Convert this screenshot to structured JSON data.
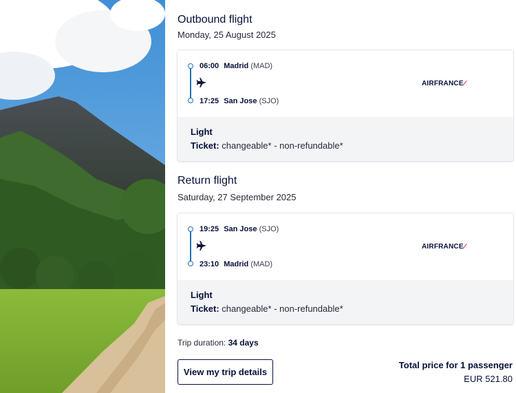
{
  "hero": {
    "icon": "volcano-landscape-image"
  },
  "outbound": {
    "title": "Outbound flight",
    "date": "Monday, 25 August 2025",
    "departure": {
      "time": "06:00",
      "city": "Madrid",
      "code": "(MAD)"
    },
    "arrival": {
      "time": "17:25",
      "city": "San Jose",
      "code": "(SJO)"
    },
    "airline": "AIRFRANCE",
    "fare": "Light",
    "ticket_label": "Ticket:",
    "ticket_value": "changeable* - non-refundable*"
  },
  "return": {
    "title": "Return flight",
    "date": "Saturday, 27 September 2025",
    "departure": {
      "time": "19:25",
      "city": "San Jose",
      "code": "(SJO)"
    },
    "arrival": {
      "time": "23:10",
      "city": "Madrid",
      "code": "(MAD)"
    },
    "airline": "AIRFRANCE",
    "fare": "Light",
    "ticket_label": "Ticket:",
    "ticket_value": "changeable* - non-refundable*"
  },
  "summary": {
    "duration_label": "Trip duration:",
    "duration_value": "34 days",
    "details_button": "View my trip details",
    "total_label": "Total price for 1 passenger",
    "total_price": "EUR 521.80"
  },
  "colors": {
    "accent": "#1d72b8",
    "text": "#051039",
    "brand_red": "#e4002b"
  }
}
